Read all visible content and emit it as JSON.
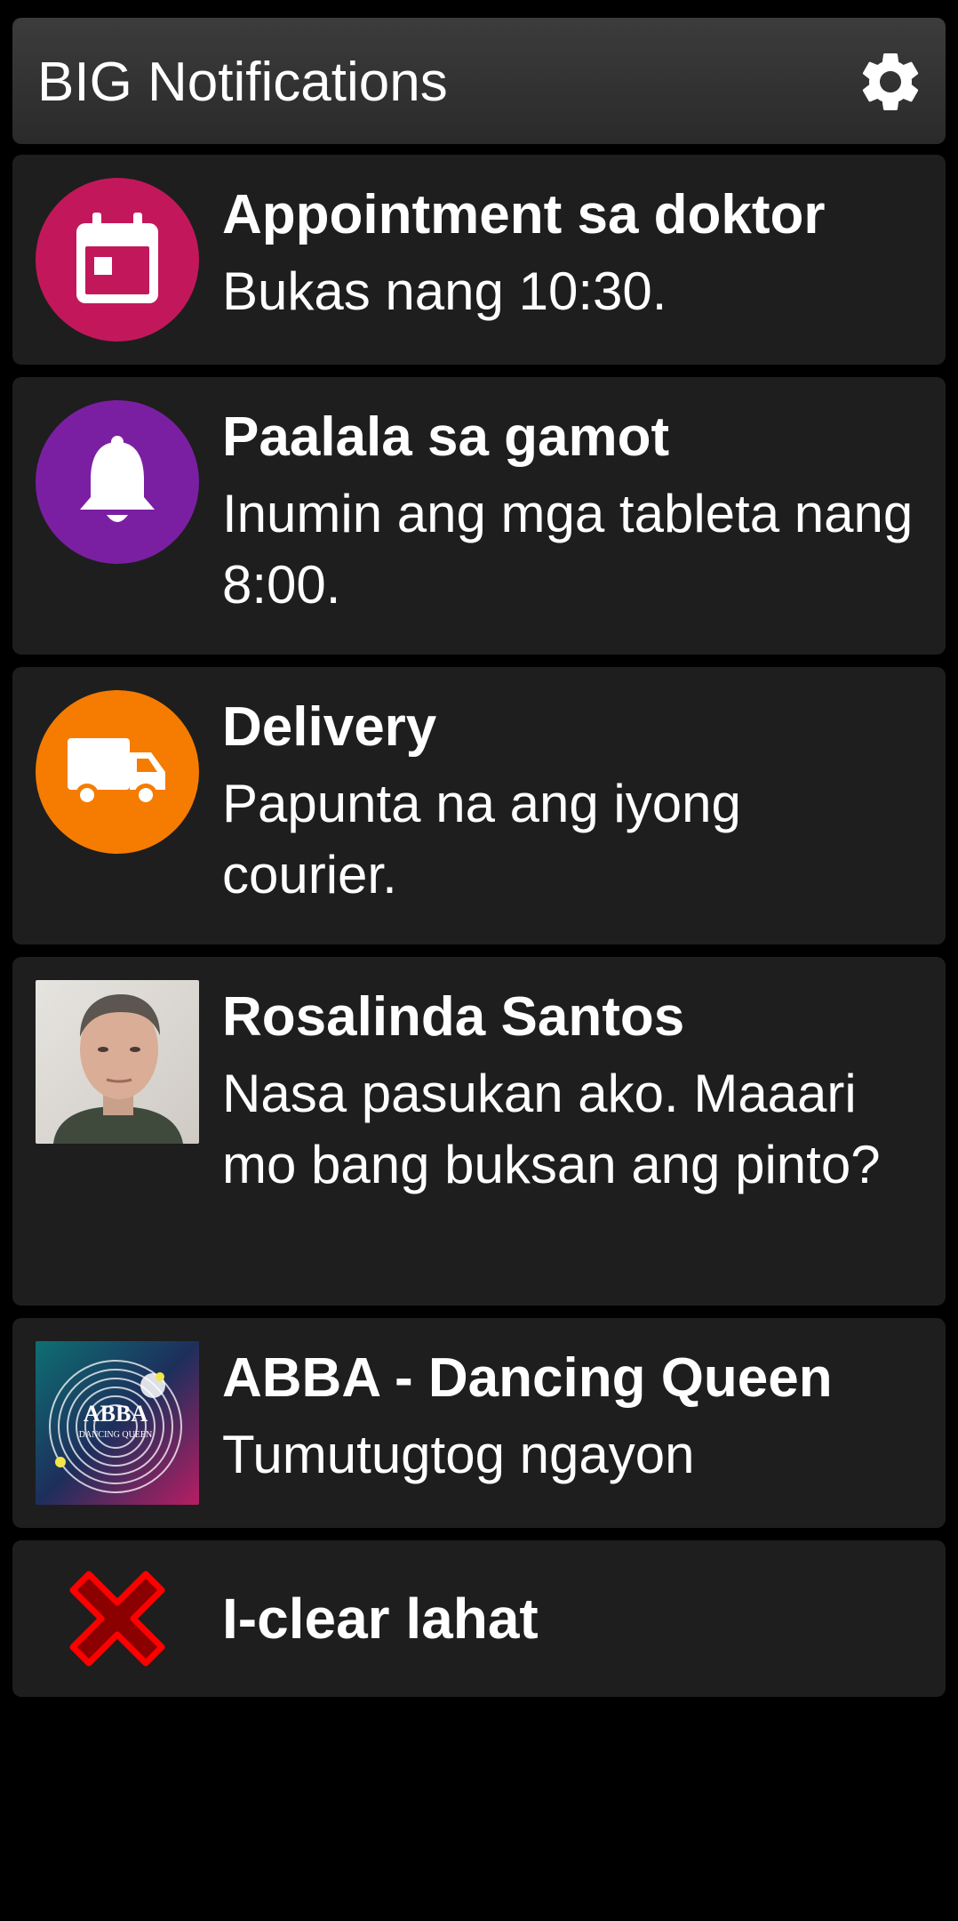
{
  "app": {
    "title": "BIG Notifications",
    "settings_icon": "gear-icon"
  },
  "notifications": [
    {
      "icon": "calendar-icon",
      "color": "#c2185b",
      "title": "Appointment sa doktor",
      "body": "Bukas nang 10:30."
    },
    {
      "icon": "bell-icon",
      "color": "#7b1fa2",
      "title": "Paalala sa gamot",
      "body": "Inumin ang mga tableta nang 8:00."
    },
    {
      "icon": "truck-icon",
      "color": "#f57c00",
      "title": "Delivery",
      "body": "Papunta na ang iyong courier."
    },
    {
      "icon": "contact-photo",
      "title": "Rosalinda Santos",
      "body": "Nasa pasukan ako. Maaari mo bang buksan ang pinto?"
    },
    {
      "icon": "album-art",
      "album_text": "ABBA",
      "album_subtext": "DANCING QUEEN",
      "title": "ABBA - Dancing Queen",
      "body": "Tumutugtog ngayon"
    }
  ],
  "clear_all": {
    "icon": "close-x-icon",
    "color": "#d50000",
    "label": "I-clear lahat"
  }
}
